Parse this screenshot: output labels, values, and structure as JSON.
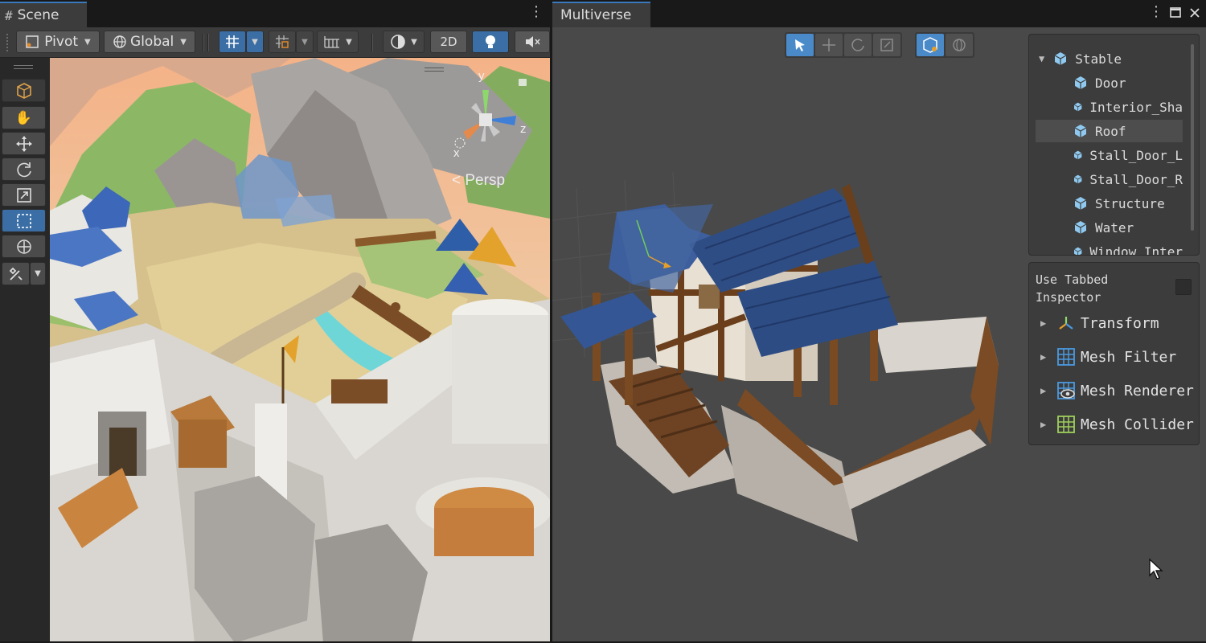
{
  "scene": {
    "tab_label": "Scene",
    "tab_icon": "#",
    "menu_icon": "⋮",
    "toolbar": {
      "pivot_label": "Pivot",
      "global_label": "Global",
      "mode_2d_label": "2D"
    },
    "gizmo": {
      "y": "y",
      "z": "z",
      "x": "x",
      "persp": "< Persp"
    }
  },
  "multiverse": {
    "tab_label": "Multiverse",
    "menu_icon": "⋮",
    "hierarchy": {
      "items": [
        {
          "label": "Stable",
          "selected": false,
          "expanded": true
        },
        {
          "label": "Door",
          "selected": false
        },
        {
          "label": "Interior_Sha",
          "selected": false
        },
        {
          "label": "Roof",
          "selected": true
        },
        {
          "label": "Stall_Door_L",
          "selected": false
        },
        {
          "label": "Stall_Door_R",
          "selected": false
        },
        {
          "label": "Structure",
          "selected": false
        },
        {
          "label": "Water",
          "selected": false
        },
        {
          "label": "Window Inter",
          "selected": false
        }
      ]
    },
    "inspector": {
      "tabbed_label": "Use Tabbed Inspector",
      "components": [
        {
          "label": "Transform",
          "icon": "transform-icon"
        },
        {
          "label": "Mesh Filter",
          "icon": "mesh-filter-icon"
        },
        {
          "label": "Mesh Renderer",
          "icon": "mesh-renderer-icon"
        },
        {
          "label": "Mesh Collider",
          "icon": "mesh-collider-icon"
        }
      ]
    }
  },
  "colors": {
    "accent": "#3a6ea5",
    "overlay_on": "#4a8ac9",
    "cube_icon": "#8fc9ef"
  }
}
